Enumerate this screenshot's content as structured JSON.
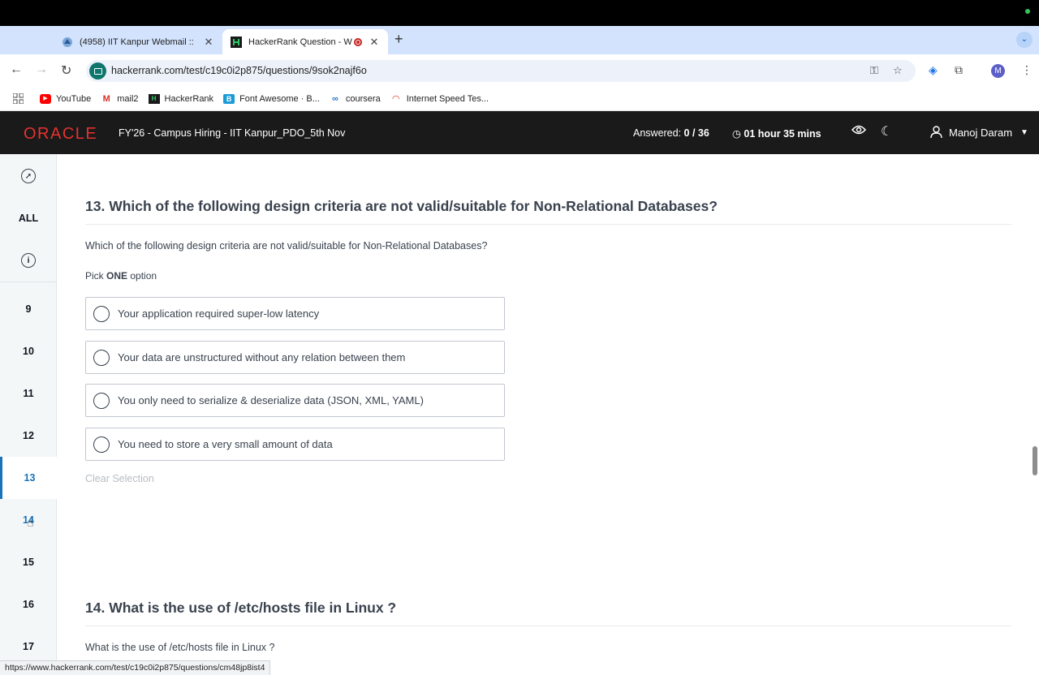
{
  "browser": {
    "tabs": [
      {
        "title": "(4958) IIT Kanpur Webmail ::",
        "active": false
      },
      {
        "title": "HackerRank Question - W",
        "active": true
      }
    ],
    "new_tab_icon": "+",
    "url": "hackerrank.com/test/c19c0i2p875/questions/9sok2najf6o",
    "profile_initial": "M",
    "bookmarks": [
      {
        "label": "YouTube",
        "icon": "youtube-icon"
      },
      {
        "label": "mail2",
        "icon": "gmail-icon"
      },
      {
        "label": "HackerRank",
        "icon": "hackerrank-icon"
      },
      {
        "label": "Font Awesome · B...",
        "icon": "fontawesome-icon"
      },
      {
        "label": "coursera",
        "icon": "coursera-icon"
      },
      {
        "label": "Internet Speed Tes...",
        "icon": "speedtest-icon"
      }
    ],
    "status_url": "https://www.hackerrank.com/test/c19c0i2p875/questions/cm48jp8ist4"
  },
  "header": {
    "logo": "ORACLE",
    "test_name": "FY'26 - Campus Hiring - IIT Kanpur_PDO_5th Nov",
    "answered_label": "Answered:",
    "answered_value": "0 / 36",
    "timer": "01 hour 35 mins",
    "user_name": "Manoj Daram"
  },
  "sidebar": {
    "all_label": "ALL",
    "numbers": [
      "9",
      "10",
      "11",
      "12",
      "13",
      "14",
      "15",
      "16",
      "17"
    ],
    "active": "13"
  },
  "question13": {
    "title": "13. Which of the following design criteria are not valid/suitable for Non-Relational Databases?",
    "text": "Which of the following design criteria are not valid/suitable for Non-Relational Databases?",
    "pick_prefix": "Pick",
    "pick_bold": "ONE",
    "pick_suffix": "option",
    "options": [
      "Your application required super-low latency",
      "Your data are unstructured without any relation between them",
      "You only need to serialize & deserialize data (JSON, XML, YAML)",
      "You need to store a very small amount of data"
    ],
    "clear_label": "Clear Selection"
  },
  "question14": {
    "title": "14. What is the use of /etc/hosts file in Linux ?",
    "text": "What is the use of /etc/hosts file in Linux ?"
  },
  "colors": {
    "header_bg": "#1a1a1a",
    "oracle_red": "#e3332f",
    "active_blue": "#1a73b8",
    "sidebar_bg": "#f3f7f7"
  }
}
